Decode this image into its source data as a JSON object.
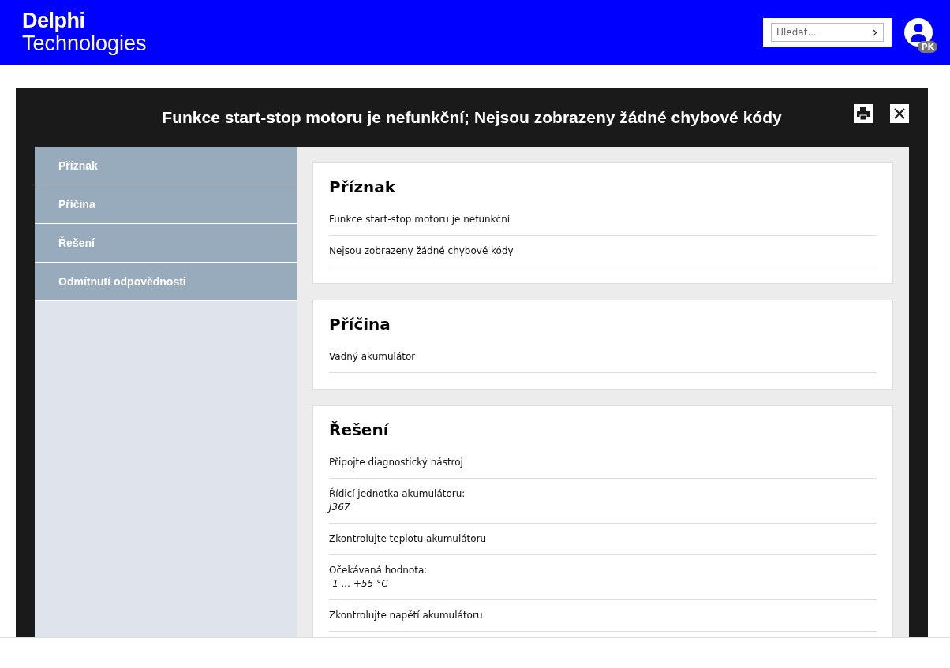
{
  "header": {
    "logo_top": "Delphi",
    "logo_bottom": "Technologies",
    "search": {
      "placeholder": "Hledat..."
    },
    "user_initials": "PK"
  },
  "modal": {
    "title": "Funkce start-stop motoru je nefunkční; Nejsou zobrazeny žádné chybové kódy",
    "nav": [
      {
        "label": "Příznak"
      },
      {
        "label": "Příčina"
      },
      {
        "label": "Řešení"
      },
      {
        "label": "Odmítnutí odpovědnosti"
      }
    ],
    "sections": [
      {
        "title": "Příznak",
        "rows": [
          {
            "text": "Funkce start-stop motoru je nefunkční"
          },
          {
            "text": "Nejsou zobrazeny žádné chybové kódy"
          }
        ]
      },
      {
        "title": "Příčina",
        "rows": [
          {
            "text": "Vadný akumulátor"
          }
        ]
      },
      {
        "title": "Řešení",
        "rows": [
          {
            "text": "Připojte diagnostický nástroj"
          },
          {
            "text": "Řídicí jednotka akumulátoru:",
            "value": "J367"
          },
          {
            "text": "Zkontrolujte teplotu akumulátoru"
          },
          {
            "text": "Očekávaná hodnota:",
            "value": "-1 ... +55 °C"
          },
          {
            "text": "Zkontrolujte napětí akumulátoru"
          }
        ]
      }
    ]
  }
}
